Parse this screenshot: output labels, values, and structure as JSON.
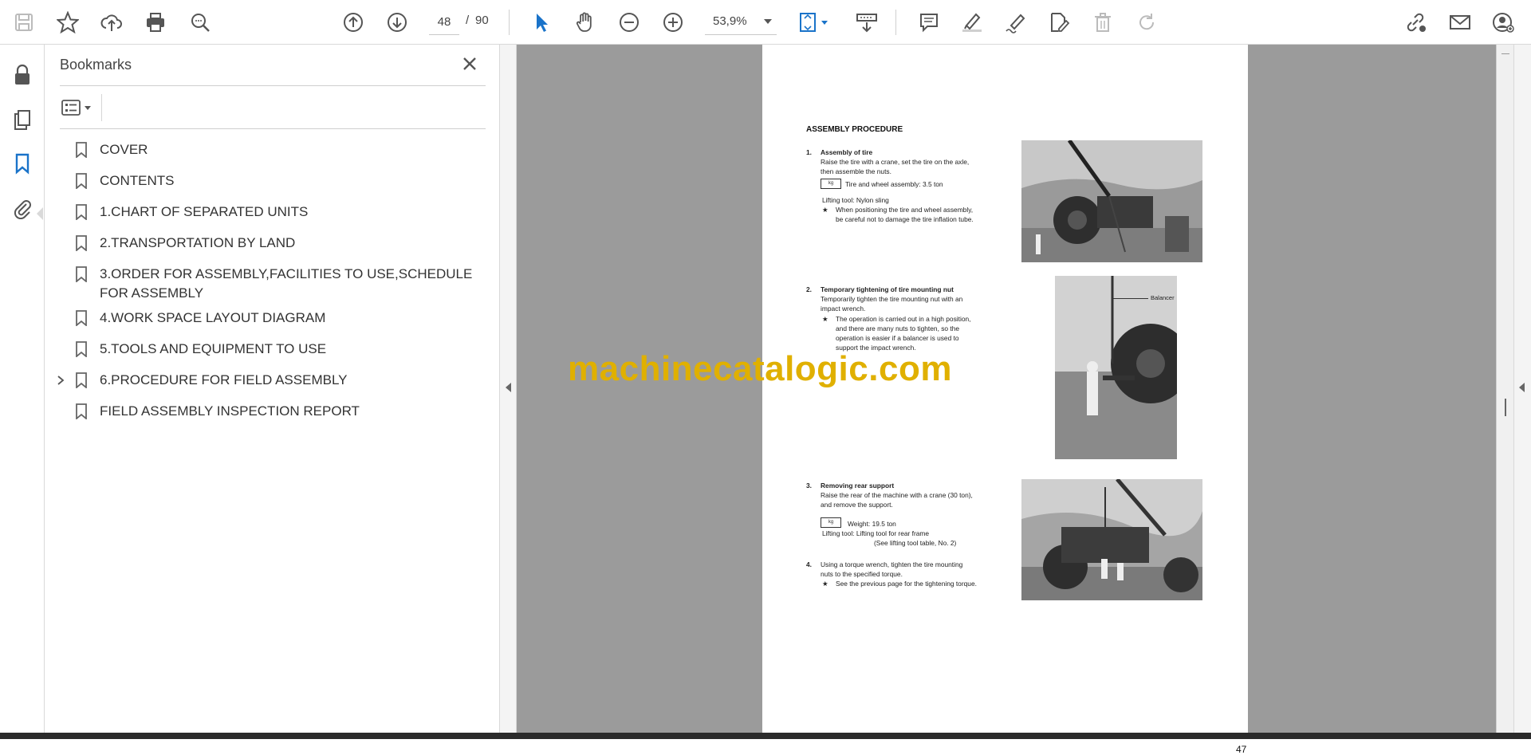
{
  "toolbar": {
    "page_current": "48",
    "page_separator": "/",
    "page_total": "90",
    "zoom": "53,9%"
  },
  "bookmarks_panel": {
    "title": "Bookmarks",
    "items": [
      {
        "label": "COVER"
      },
      {
        "label": "CONTENTS"
      },
      {
        "label": "1.CHART OF SEPARATED UNITS"
      },
      {
        "label": "2.TRANSPORTATION BY LAND"
      },
      {
        "label": "3.ORDER FOR ASSEMBLY,FACILITIES TO USE,SCHEDULE FOR ASSEMBLY"
      },
      {
        "label": "4.WORK SPACE LAYOUT DIAGRAM"
      },
      {
        "label": "5.TOOLS AND EQUIPMENT TO USE"
      },
      {
        "label": "6.PROCEDURE FOR FIELD ASSEMBLY"
      },
      {
        "label": "FIELD ASSEMBLY INSPECTION REPORT"
      }
    ]
  },
  "document": {
    "heading": "ASSEMBLY PROCEDURE",
    "step1": {
      "num": "1.",
      "title": "Assembly of tire",
      "line1": "Raise the tire with a crane, set the tire on the axle,",
      "line2": "then assemble the nuts.",
      "kg_label": "kg",
      "weight": "Tire and wheel assembly:  3.5 ton",
      "tool": "Lifting tool:     Nylon sling",
      "star": "★",
      "note1": "When positioning the tire and wheel assembly,",
      "note2": "be careful not to damage the tire inflation tube."
    },
    "step2": {
      "num": "2.",
      "title": "Temporary tightening of tire mounting nut",
      "line1": "Temporarily tighten the tire mounting nut with an",
      "line2": "impact wrench.",
      "star": "★",
      "note1": "The operation is carried out in a high position,",
      "note2": "and there are many nuts to tighten, so the",
      "note3": "operation is easier if a balancer is used to",
      "note4": "support the impact wrench.",
      "callout": "Balancer"
    },
    "step3": {
      "num": "3.",
      "title": "Removing rear support",
      "line1": "Raise the rear of the machine with a crane (30 ton),",
      "line2": "and remove the support.",
      "kg_label": "kg",
      "weight": "Weight:  19.5 ton",
      "tool": "Lifting tool:     Lifting tool for rear frame",
      "tool2": "(See lifting tool table, No. 2)"
    },
    "step4": {
      "num": "4.",
      "line1": "Using a torque wrench, tighten the tire mounting",
      "line2": "nuts to the specified torque.",
      "star": "★",
      "note1": "See the previous page for the tightening torque."
    },
    "page_number": "47",
    "watermark": "machinecatalogic.com"
  }
}
